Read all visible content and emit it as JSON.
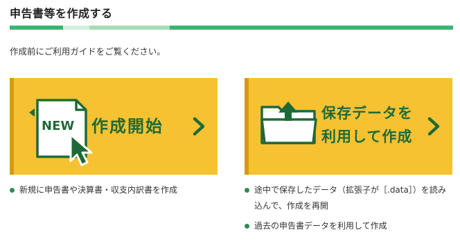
{
  "page": {
    "title": "申告書等を作成する",
    "intro": "作成前にご利用ガイドをご覧ください。"
  },
  "progress": {
    "colors": [
      "#3cb371",
      "#d4eedd",
      "#a5ddb9",
      "#3cb371"
    ]
  },
  "cards": {
    "new": {
      "badge": "NEW",
      "title": "作成開始",
      "icon": "new-document-cursor-icon"
    },
    "saved": {
      "title_line1": "保存データを",
      "title_line2": "利用して作成",
      "icon": "folder-upload-icon"
    },
    "accent_color": "#f7c232",
    "text_color": "#1e6a37"
  },
  "bullets": {
    "new": [
      "新規に申告書や決算書・収支内訳書を作成"
    ],
    "saved": [
      "途中で保存したデータ（拡張子が［.data］）を読み込んで、作成を再開",
      "過去の申告書データを利用して作成"
    ]
  }
}
